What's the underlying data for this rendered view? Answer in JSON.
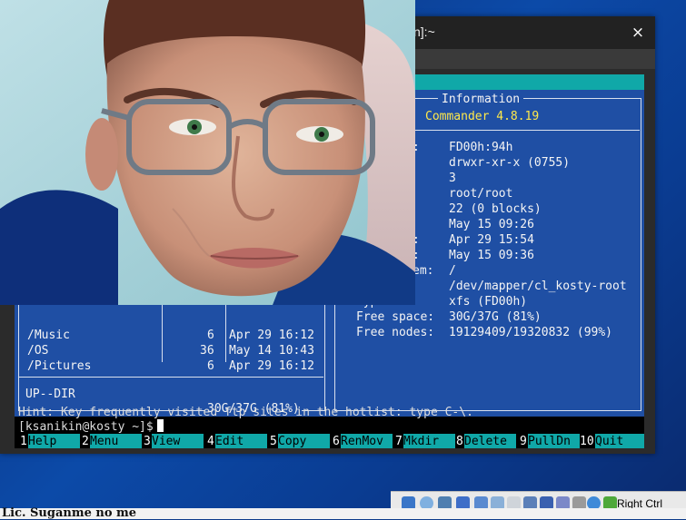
{
  "window": {
    "title": "n]:~",
    "close_label": "×"
  },
  "left_panel": {
    "rows": [
      {
        "name": "/Music",
        "size": "6",
        "mtime": "Apr 29 16:12"
      },
      {
        "name": "/OS",
        "size": "36",
        "mtime": "May 14 10:43"
      },
      {
        "name": "/Pictures",
        "size": "6",
        "mtime": "Apr 29 16:12"
      }
    ],
    "status": "UP--DIR",
    "disk": "30G/37G (81%)"
  },
  "info_panel": {
    "header": "Information",
    "version": "Commander 4.8.19",
    "fields": [
      {
        "label": ":",
        "value": "FD00h:94h"
      },
      {
        "label": "",
        "value": "drwxr-xr-x (0755)"
      },
      {
        "label": "",
        "value": "3"
      },
      {
        "label": "",
        "value": "root/root"
      },
      {
        "label": "",
        "value": "22 (0 blocks)"
      },
      {
        "label": "",
        "value": "May 15 09:26"
      },
      {
        "label": ":",
        "value": "Apr 29 15:54"
      },
      {
        "label": ":",
        "value": "May 15 09:36"
      },
      {
        "label": "em:",
        "value": "/"
      },
      {
        "label": "",
        "value": "/dev/mapper/cl_kosty-root"
      },
      {
        "label": "Type:",
        "value": "xfs (FD00h)"
      },
      {
        "label": "Free space:",
        "value": "30G/37G (81%)"
      },
      {
        "label": "Free nodes:",
        "value": "19129409/19320832 (99%)"
      }
    ]
  },
  "terminal": {
    "hint": "Hint: Key frequently visited ftp sites in the hotlist: type C-\\.",
    "prompt": "[ksanikin@kosty ~]$"
  },
  "function_keys": [
    {
      "num": "1",
      "label": "Help"
    },
    {
      "num": "2",
      "label": "Menu"
    },
    {
      "num": "3",
      "label": "View"
    },
    {
      "num": "4",
      "label": "Edit"
    },
    {
      "num": "5",
      "label": "Copy"
    },
    {
      "num": "6",
      "label": "RenMov"
    },
    {
      "num": "7",
      "label": "Mkdir"
    },
    {
      "num": "8",
      "label": "Delete"
    },
    {
      "num": "9",
      "label": "PullDn"
    },
    {
      "num": "10",
      "label": "Quit"
    }
  ],
  "taskbar": {
    "host_key": "Right Ctrl",
    "icons": [
      "hdd-icon",
      "cd-icon",
      "usb-icon",
      "network-icon",
      "pen-icon",
      "folder-icon",
      "display-icon",
      "screen-icon",
      "recording-icon",
      "mouse-icon",
      "arrow-icon"
    ]
  },
  "host_bottom_text": "Lic.    Suganme no me"
}
